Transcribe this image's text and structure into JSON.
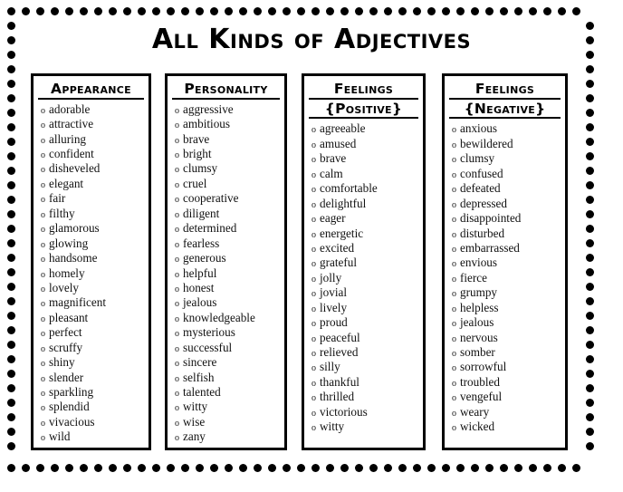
{
  "poster": {
    "title": "All Kinds of Adjectives",
    "bullet_glyph": "o",
    "border": {
      "style": "dotted",
      "dot_color": "#000000"
    },
    "box_border_color": "#000000",
    "background_color": "#ffffff",
    "text_color": "#111111"
  },
  "columns": [
    {
      "header_lines": [
        "Appearance"
      ],
      "words": [
        "adorable",
        "attractive",
        "alluring",
        "confident",
        "disheveled",
        "elegant",
        "fair",
        "filthy",
        "glamorous",
        "glowing",
        "handsome",
        "homely",
        "lovely",
        "magnificent",
        "pleasant",
        "perfect",
        "scruffy",
        "shiny",
        "slender",
        "sparkling",
        "splendid",
        "vivacious",
        "wild"
      ]
    },
    {
      "header_lines": [
        "Personality"
      ],
      "words": [
        "aggressive",
        "ambitious",
        "brave",
        "bright",
        "clumsy",
        "cruel",
        "cooperative",
        "diligent",
        "determined",
        "fearless",
        "generous",
        "helpful",
        "honest",
        "jealous",
        "knowledgeable",
        "mysterious",
        "successful",
        "sincere",
        "selfish",
        "talented",
        "witty",
        "wise",
        "zany"
      ]
    },
    {
      "header_lines": [
        "Feelings",
        "{Positive}"
      ],
      "words": [
        "agreeable",
        "amused",
        "brave",
        "calm",
        "comfortable",
        "delightful",
        "eager",
        "energetic",
        "excited",
        "grateful",
        "jolly",
        "jovial",
        "lively",
        "proud",
        "peaceful",
        "relieved",
        "silly",
        "thankful",
        "thrilled",
        "victorious",
        "witty"
      ]
    },
    {
      "header_lines": [
        "Feelings",
        "{Negative}"
      ],
      "words": [
        "anxious",
        "bewildered",
        "clumsy",
        "confused",
        "defeated",
        "depressed",
        "disappointed",
        "disturbed",
        "embarrassed",
        "envious",
        "fierce",
        "grumpy",
        "helpless",
        "jealous",
        "nervous",
        "somber",
        "sorrowful",
        "troubled",
        "vengeful",
        "weary",
        "wicked"
      ]
    }
  ]
}
